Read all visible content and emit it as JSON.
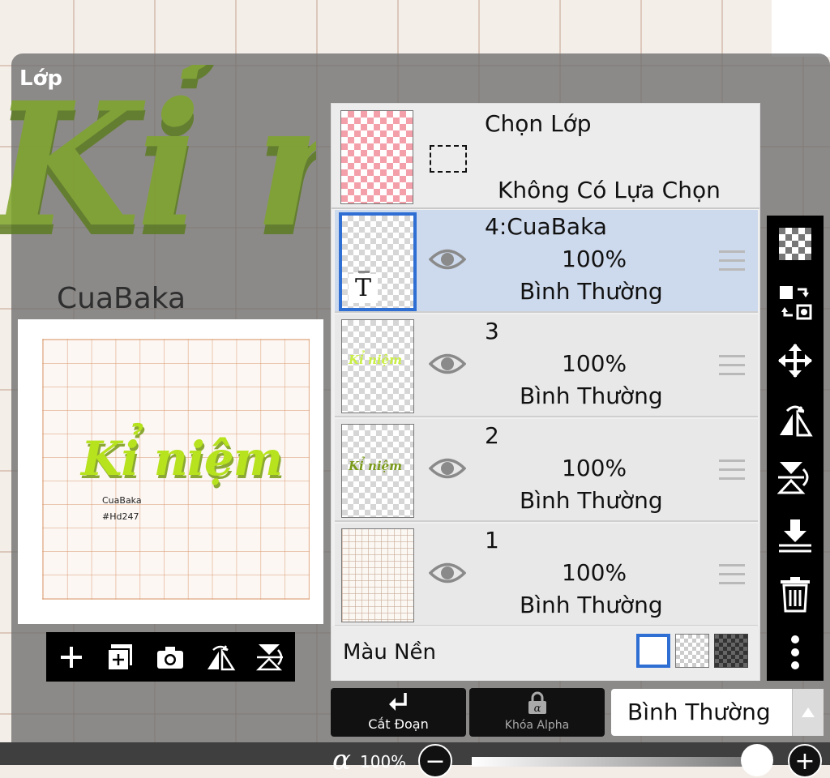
{
  "panel": {
    "title": "Lớp",
    "background_art_text": "Kỉ niệm",
    "author_tag": "CuaBaka"
  },
  "preview": {
    "title": "Kỉ niệm",
    "line1": "CuaBaka",
    "line2": "#Hd247"
  },
  "preview_toolbar": {
    "items": [
      "add-layer-icon",
      "add-layer-copy-icon",
      "camera-icon",
      "flip-horizontal-icon",
      "flip-vertical-icon"
    ]
  },
  "selection_layer": {
    "title": "Chọn Lớp",
    "status": "Không Có Lựa Chọn"
  },
  "layers": [
    {
      "name": "4:CuaBaka",
      "opacity": "100%",
      "blend": "Bình Thường",
      "active": true,
      "thumb_text": "T"
    },
    {
      "name": "3",
      "opacity": "100%",
      "blend": "Bình Thường",
      "active": false
    },
    {
      "name": "2",
      "opacity": "100%",
      "blend": "Bình Thường",
      "active": false
    },
    {
      "name": "1",
      "opacity": "100%",
      "blend": "Bình Thường",
      "active": false
    }
  ],
  "background_color": {
    "label": "Màu Nền",
    "options": [
      "white",
      "transparent",
      "dark-checker"
    ],
    "selected": "white"
  },
  "right_toolbar": {
    "items": [
      "checker-icon",
      "transform-icon",
      "move-icon",
      "flip-horizontal-icon",
      "flip-vertical-icon",
      "merge-down-icon",
      "trash-icon",
      "more-icon"
    ]
  },
  "bottom": {
    "clip_label": "Cắt Đoạn",
    "alpha_lock_label": "Khóa Alpha",
    "blend_mode": "Bình Thường",
    "alpha_symbol": "α",
    "alpha_value": "100%",
    "minus": "−",
    "plus": "+"
  },
  "colors": {
    "accent": "#2f6fd4",
    "active_row": "#cdd9ec",
    "art_green": "#b7e21e"
  }
}
